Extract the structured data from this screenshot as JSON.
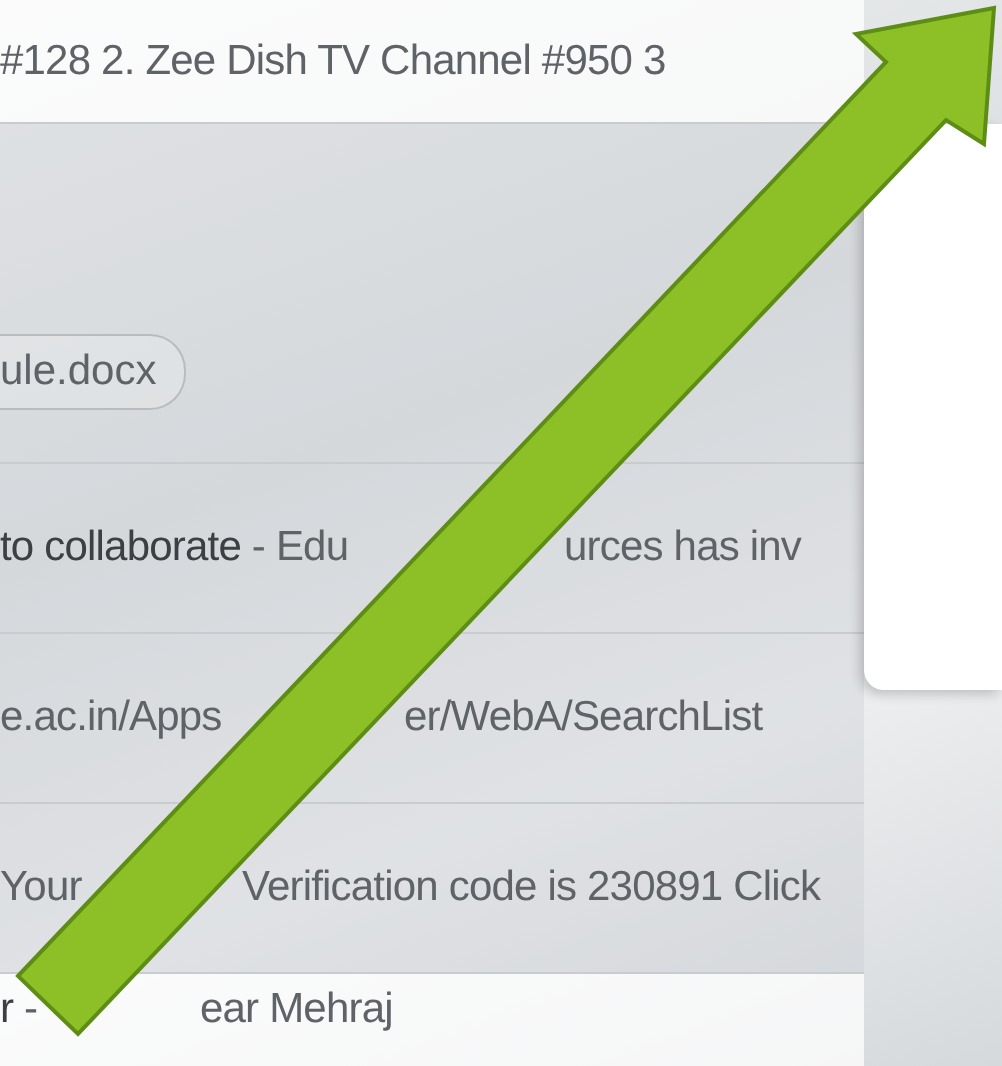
{
  "rows": [
    {
      "shaded": false,
      "parts": [
        "#128 2. Zee Dish TV Channel #950 3"
      ]
    },
    {
      "shaded": true,
      "attachment": "ule.docx"
    },
    {
      "shaded": true,
      "parts": [
        "**to collaborate** - Edu",
        "urces has inv"
      ]
    },
    {
      "shaded": true,
      "parts": [
        "e.ac.in/Apps",
        "er/WebA/SearchList"
      ]
    },
    {
      "shaded": true,
      "parts": [
        "Your",
        "Verification code is 230891 Click"
      ]
    },
    {
      "shaded": false,
      "parts": [
        "**r** -",
        "ear Mehraj"
      ]
    }
  ]
}
